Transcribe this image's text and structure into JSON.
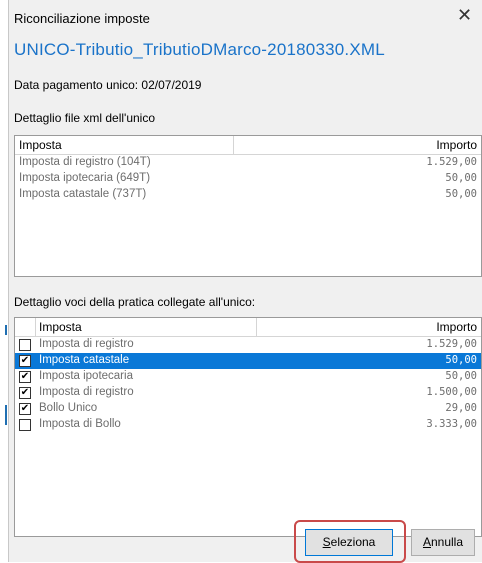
{
  "window": {
    "title": "Riconciliazione imposte",
    "close_glyph": "✕"
  },
  "file_name": "UNICO-Tributio_TributioDMarco-20180330.XML",
  "payment_date_label": "Data pagamento unico: 02/07/2019",
  "xml_section": {
    "label": "Dettaglio file xml dell'unico",
    "headers": {
      "col1": "Imposta",
      "col2": "Importo"
    },
    "rows": [
      {
        "name": "Imposta di registro (104T)",
        "amount": "1.529,00"
      },
      {
        "name": "Imposta ipotecaria (649T)",
        "amount": "50,00"
      },
      {
        "name": "Imposta catastale (737T)",
        "amount": "50,00"
      }
    ]
  },
  "linked_section": {
    "label": "Dettaglio voci della pratica collegate all'unico:",
    "headers": {
      "col1": "Imposta",
      "col2": "Importo"
    },
    "rows": [
      {
        "name": "Imposta di registro",
        "amount": "1.529,00",
        "checked": false,
        "selected": false
      },
      {
        "name": "Imposta catastale",
        "amount": "50,00",
        "checked": true,
        "selected": true
      },
      {
        "name": "Imposta ipotecaria",
        "amount": "50,00",
        "checked": true,
        "selected": false
      },
      {
        "name": "Imposta di registro",
        "amount": "1.500,00",
        "checked": true,
        "selected": false
      },
      {
        "name": "Bollo Unico",
        "amount": "29,00",
        "checked": true,
        "selected": false
      },
      {
        "name": "Imposta di Bollo",
        "amount": "3.333,00",
        "checked": false,
        "selected": false
      }
    ]
  },
  "buttons": {
    "select": {
      "mnemonic": "S",
      "rest": "eleziona"
    },
    "cancel": {
      "mnemonic": "A",
      "rest": "nnulla"
    }
  },
  "colors": {
    "accent": "#1a73c9",
    "selection": "#0a78d7",
    "highlight_outline": "#c94a4a"
  },
  "icons": {
    "close": "close-icon",
    "checkbox_checked": "checkmark-icon"
  }
}
